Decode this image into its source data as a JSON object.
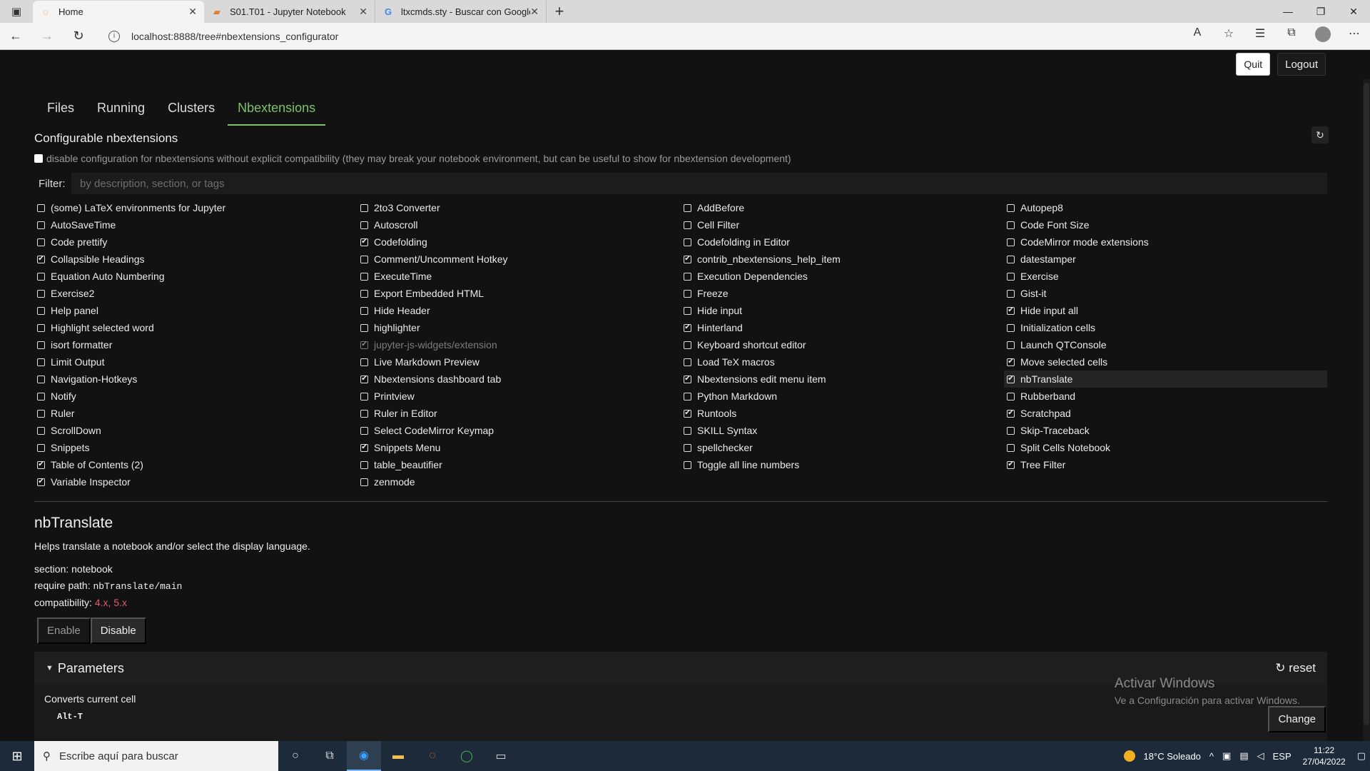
{
  "browser": {
    "tabs": [
      {
        "title": "Home",
        "icon": "jupyter-icon",
        "active": true
      },
      {
        "title": "S01.T01 - Jupyter Notebook",
        "icon": "notebook-icon",
        "active": false
      },
      {
        "title": "ltxcmds.sty - Buscar con Google",
        "icon": "google-icon",
        "active": false
      }
    ],
    "url": "localhost:8888/tree#nbextensions_configurator"
  },
  "header": {
    "quit_label": "Quit",
    "logout_label": "Logout"
  },
  "main_tabs": [
    "Files",
    "Running",
    "Clusters",
    "Nbextensions"
  ],
  "active_tab": "Nbextensions",
  "configurator": {
    "title": "Configurable nbextensions",
    "compat_text": "disable configuration for nbextensions without explicit compatibility (they may break your notebook environment, but can be useful to show for nbextension development)",
    "filter_label": "Filter:",
    "filter_placeholder": "by description, section, or tags"
  },
  "extensions": [
    {
      "name": "(some) LaTeX environments for Jupyter",
      "checked": false
    },
    {
      "name": "2to3 Converter",
      "checked": false
    },
    {
      "name": "AddBefore",
      "checked": false
    },
    {
      "name": "Autopep8",
      "checked": false
    },
    {
      "name": "AutoSaveTime",
      "checked": false
    },
    {
      "name": "Autoscroll",
      "checked": false
    },
    {
      "name": "Cell Filter",
      "checked": false
    },
    {
      "name": "Code Font Size",
      "checked": false
    },
    {
      "name": "Code prettify",
      "checked": false
    },
    {
      "name": "Codefolding",
      "checked": true
    },
    {
      "name": "Codefolding in Editor",
      "checked": false
    },
    {
      "name": "CodeMirror mode extensions",
      "checked": false
    },
    {
      "name": "Collapsible Headings",
      "checked": true
    },
    {
      "name": "Comment/Uncomment Hotkey",
      "checked": false
    },
    {
      "name": "contrib_nbextensions_help_item",
      "checked": true
    },
    {
      "name": "datestamper",
      "checked": false
    },
    {
      "name": "Equation Auto Numbering",
      "checked": false
    },
    {
      "name": "ExecuteTime",
      "checked": false
    },
    {
      "name": "Execution Dependencies",
      "checked": false
    },
    {
      "name": "Exercise",
      "checked": false
    },
    {
      "name": "Exercise2",
      "checked": false
    },
    {
      "name": "Export Embedded HTML",
      "checked": false
    },
    {
      "name": "Freeze",
      "checked": false
    },
    {
      "name": "Gist-it",
      "checked": false
    },
    {
      "name": "Help panel",
      "checked": false
    },
    {
      "name": "Hide Header",
      "checked": false
    },
    {
      "name": "Hide input",
      "checked": false
    },
    {
      "name": "Hide input all",
      "checked": true
    },
    {
      "name": "Highlight selected word",
      "checked": false
    },
    {
      "name": "highlighter",
      "checked": false
    },
    {
      "name": "Hinterland",
      "checked": true
    },
    {
      "name": "Initialization cells",
      "checked": false
    },
    {
      "name": "isort formatter",
      "checked": false
    },
    {
      "name": "jupyter-js-widgets/extension",
      "checked": true,
      "dim": true
    },
    {
      "name": "Keyboard shortcut editor",
      "checked": false
    },
    {
      "name": "Launch QTConsole",
      "checked": false
    },
    {
      "name": "Limit Output",
      "checked": false
    },
    {
      "name": "Live Markdown Preview",
      "checked": false
    },
    {
      "name": "Load TeX macros",
      "checked": false
    },
    {
      "name": "Move selected cells",
      "checked": true
    },
    {
      "name": "Navigation-Hotkeys",
      "checked": false
    },
    {
      "name": "Nbextensions dashboard tab",
      "checked": true
    },
    {
      "name": "Nbextensions edit menu item",
      "checked": true
    },
    {
      "name": "nbTranslate",
      "checked": true,
      "highlight": true
    },
    {
      "name": "Notify",
      "checked": false
    },
    {
      "name": "Printview",
      "checked": false
    },
    {
      "name": "Python Markdown",
      "checked": false
    },
    {
      "name": "Rubberband",
      "checked": false
    },
    {
      "name": "Ruler",
      "checked": false
    },
    {
      "name": "Ruler in Editor",
      "checked": false
    },
    {
      "name": "Runtools",
      "checked": true
    },
    {
      "name": "Scratchpad",
      "checked": true
    },
    {
      "name": "ScrollDown",
      "checked": false
    },
    {
      "name": "Select CodeMirror Keymap",
      "checked": false
    },
    {
      "name": "SKILL Syntax",
      "checked": false
    },
    {
      "name": "Skip-Traceback",
      "checked": false
    },
    {
      "name": "Snippets",
      "checked": false
    },
    {
      "name": "Snippets Menu",
      "checked": true
    },
    {
      "name": "spellchecker",
      "checked": false
    },
    {
      "name": "Split Cells Notebook",
      "checked": false
    },
    {
      "name": "Table of Contents (2)",
      "checked": true
    },
    {
      "name": "table_beautifier",
      "checked": false
    },
    {
      "name": "Toggle all line numbers",
      "checked": false
    },
    {
      "name": "Tree Filter",
      "checked": true
    },
    {
      "name": "Variable Inspector",
      "checked": true
    },
    {
      "name": "zenmode",
      "checked": false
    }
  ],
  "detail": {
    "title": "nbTranslate",
    "description": "Helps translate a notebook and/or select the display language.",
    "section_label": "section:",
    "section_value": "notebook",
    "require_label": "require path:",
    "require_value": "nbTranslate/main",
    "compat_label": "compatibility:",
    "compat_value": "4.x, 5.x",
    "enable_label": "Enable",
    "disable_label": "Disable"
  },
  "parameters": {
    "title": "Parameters",
    "reset_label": "reset",
    "param_label": "Converts current cell",
    "param_value": "Alt-T",
    "change_label": "Change"
  },
  "watermark": {
    "title": "Activar Windows",
    "subtitle": "Ve a Configuración para activar Windows."
  },
  "taskbar": {
    "search_placeholder": "Escribe aquí para buscar",
    "weather": "18°C  Soleado",
    "lang": "ESP",
    "time": "11:22",
    "date": "27/04/2022"
  }
}
